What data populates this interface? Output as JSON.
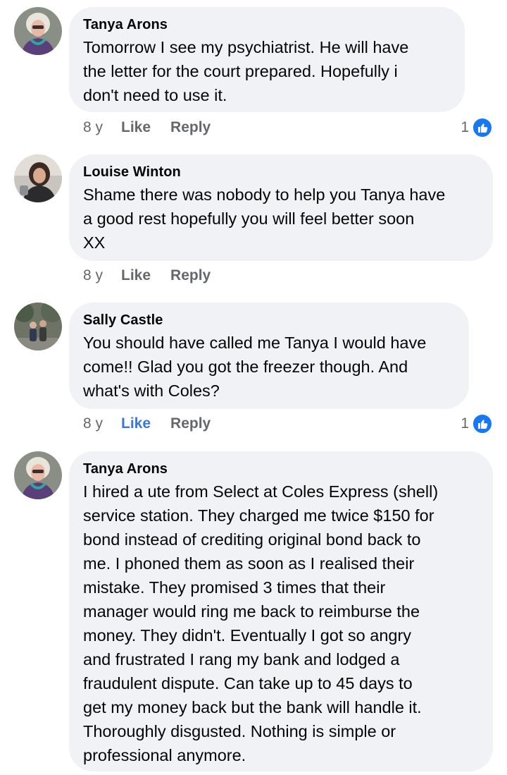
{
  "comments": [
    {
      "author": "Tanya Arons",
      "text": "Tomorrow I  see my psychiatrist.  He will have\nthe letter for the court prepared.  Hopefully i\ndon't need to use it.",
      "time": "8 y",
      "like_label": "Like",
      "reply_label": "Reply",
      "reaction_count": "1",
      "reaction_icon": "thumbs-up-icon"
    },
    {
      "author": "Louise Winton",
      "text": "Shame there was nobody to help you Tanya have\na good rest hopefully you will feel better soon\nXX",
      "time": "8 y",
      "like_label": "Like",
      "reply_label": "Reply"
    },
    {
      "author": "Sally Castle",
      "text": "You should have called me Tanya I would have\ncome!! Glad you got the freezer though. And\nwhat's with Coles?",
      "time": "8 y",
      "like_label": "Like",
      "reply_label": "Reply",
      "reaction_count": "1",
      "reaction_icon": "thumbs-up-icon",
      "liked_by_viewer": true
    },
    {
      "author": "Tanya Arons",
      "text": "I hired a ute from Select at Coles Express (shell)\nservice station.  They charged me twice $150 for\nbond instead of crediting original bond back to\nme. I phoned them as soon as I realised their\nmistake.  They promised 3 times that their\nmanager would ring me back to reimburse the\nmoney.  They didn't.  Eventually I got so angry\nand frustrated I rang my bank and lodged a\nfraudulent dispute.  Can take up to 45 days to\nget my money back but the bank will handle it.\nThoroughly disgusted.  Nothing is simple or\nprofessional anymore."
    }
  ],
  "colors": {
    "bubble": "#f0f2f5",
    "meta_text": "#65676b",
    "like_active": "#3b78d8",
    "reaction_blue": "#1877f2"
  }
}
